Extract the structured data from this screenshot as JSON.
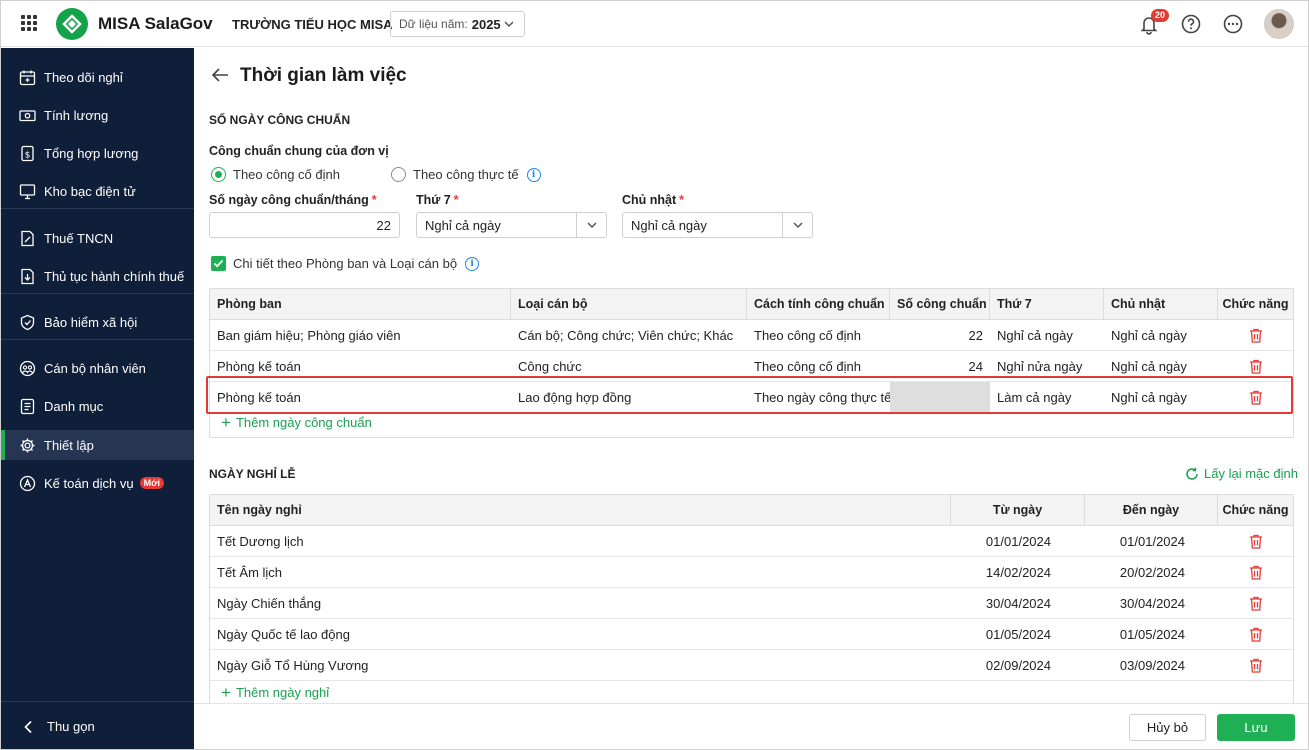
{
  "header": {
    "brand": "MISA SalaGov",
    "org": "TRƯỜNG TIỂU HỌC MISA",
    "year_label": "Dữ liệu năm:",
    "year_value": "2025",
    "notification_count": "20"
  },
  "sidebar": {
    "items": [
      {
        "label": "Theo dõi nghỉ",
        "icon": "calendar-icon"
      },
      {
        "label": "Tính lương",
        "icon": "money-icon"
      },
      {
        "label": "Tổng hợp lương",
        "icon": "salary-sheet-icon"
      },
      {
        "label": "Kho bạc điện tử",
        "icon": "monitor-icon"
      },
      {
        "label": "Thuế TNCN",
        "icon": "tax-document-icon"
      },
      {
        "label": "Thủ tục hành chính thuế",
        "icon": "tax-procedure-icon"
      },
      {
        "label": "Bảo hiểm xã hội",
        "icon": "shield-icon"
      },
      {
        "label": "Cán bộ nhân viên",
        "icon": "people-icon"
      },
      {
        "label": "Danh mục",
        "icon": "list-icon"
      },
      {
        "label": "Thiết lập",
        "icon": "gear-icon"
      },
      {
        "label": "Kế toán dịch vụ",
        "icon": "accounting-icon",
        "badge": "Mới"
      }
    ],
    "collapse_label": "Thu gọn"
  },
  "page": {
    "title": "Thời gian làm việc"
  },
  "standard_days": {
    "section_title": "SỐ NGÀY CÔNG CHUẨN",
    "general_label": "Công chuẩn chung của đơn vị",
    "radio_fixed": "Theo công cố định",
    "radio_actual": "Theo công thực tế",
    "days_per_month_label": "Số ngày công chuẩn/tháng",
    "days_per_month_value": "22",
    "saturday_label": "Thứ 7",
    "saturday_value": "Nghỉ cả ngày",
    "sunday_label": "Chủ nhật",
    "sunday_value": "Nghỉ cả ngày",
    "detail_checkbox_label": "Chi tiết theo Phòng ban và Loại cán bộ",
    "columns": [
      "Phòng ban",
      "Loại cán bộ",
      "Cách tính công chuẩn",
      "Số công chuẩn",
      "Thứ 7",
      "Chủ nhật",
      "Chức năng"
    ],
    "rows": [
      {
        "department": "Ban giám hiệu; Phòng giáo viên",
        "staff_type": "Cán bộ; Công chức; Viên chức; Khác",
        "method": "Theo công cố định",
        "days": "22",
        "saturday": "Nghỉ cả ngày",
        "sunday": "Nghỉ cả ngày"
      },
      {
        "department": "Phòng kế toán",
        "staff_type": "Công chức",
        "method": "Theo công cố định",
        "days": "24",
        "saturday": "Nghỉ nửa ngày",
        "sunday": "Nghỉ cả ngày"
      },
      {
        "department": "Phòng kế toán",
        "staff_type": "Lao động hợp đồng",
        "method": "Theo ngày công thực tế",
        "days": "",
        "saturday": "Làm cả ngày",
        "sunday": "Nghỉ cả ngày"
      }
    ],
    "add_label": "Thêm ngày công chuẩn"
  },
  "holidays": {
    "section_title": "NGÀY NGHỈ LỄ",
    "reset_label": "Lấy lại mặc định",
    "columns": [
      "Tên ngày nghỉ",
      "Từ ngày",
      "Đến ngày",
      "Chức năng"
    ],
    "rows": [
      {
        "name": "Tết Dương lịch",
        "from": "01/01/2024",
        "to": "01/01/2024"
      },
      {
        "name": "Tết Âm lịch",
        "from": "14/02/2024",
        "to": "20/02/2024"
      },
      {
        "name": "Ngày Chiến thắng",
        "from": "30/04/2024",
        "to": "30/04/2024"
      },
      {
        "name": "Ngày Quốc tế lao động",
        "from": "01/05/2024",
        "to": "01/05/2024"
      },
      {
        "name": "Ngày Giỗ Tổ Hùng Vương",
        "from": "02/09/2024",
        "to": "03/09/2024"
      }
    ],
    "add_label": "Thêm ngày nghỉ"
  },
  "footer": {
    "cancel_label": "Hủy bỏ",
    "save_label": "Lưu"
  },
  "colors": {
    "accent": "#1fb056",
    "sidebar_bg": "#0f1f3a",
    "highlight": "#e53935"
  }
}
